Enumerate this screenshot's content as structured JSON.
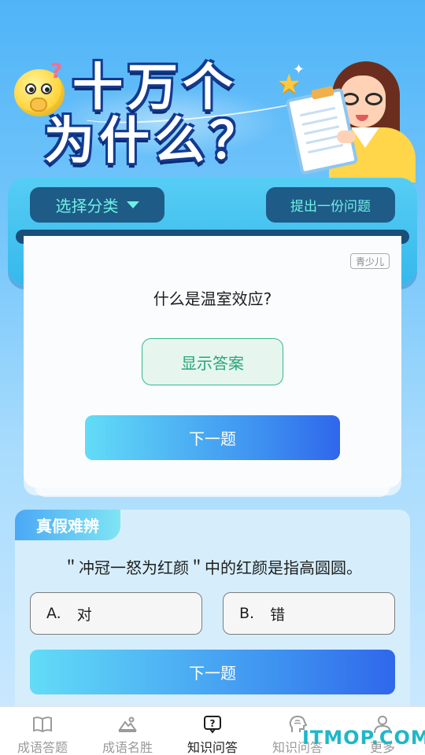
{
  "hero": {
    "title_line1": "十万个",
    "title_line2": "为什么？"
  },
  "toolbar": {
    "category_label": "选择分类",
    "ask_label": "提出一份问题"
  },
  "question_card": {
    "age_tag": "青少儿",
    "question": "什么是温室效应?",
    "show_answer_label": "显示答案",
    "next_label": "下一题"
  },
  "true_false": {
    "tag": "真假难辨",
    "statement": "＂冲冠一怒为红颜＂中的红颜是指高圆圆。",
    "option_a_letter": "A.",
    "option_a_text": "对",
    "option_b_letter": "B.",
    "option_b_text": "错",
    "next_label": "下一题"
  },
  "nav": {
    "items": [
      {
        "label": "成语答题",
        "icon": "book-icon"
      },
      {
        "label": "成语名胜",
        "icon": "landscape-icon"
      },
      {
        "label": "知识问答",
        "icon": "question-bubble-icon"
      },
      {
        "label": "知识问答",
        "icon": "brain-head-icon"
      },
      {
        "label": "更多",
        "icon": "person-icon"
      }
    ],
    "active_index": 2
  },
  "watermark": "ITMOP.COM",
  "colors": {
    "accent_teal": "#6ff0e4",
    "dark_button": "#1e5b86",
    "show_answer_green": "#27a57a",
    "gradient_start": "#62dcf7",
    "gradient_end": "#2f67eb"
  }
}
